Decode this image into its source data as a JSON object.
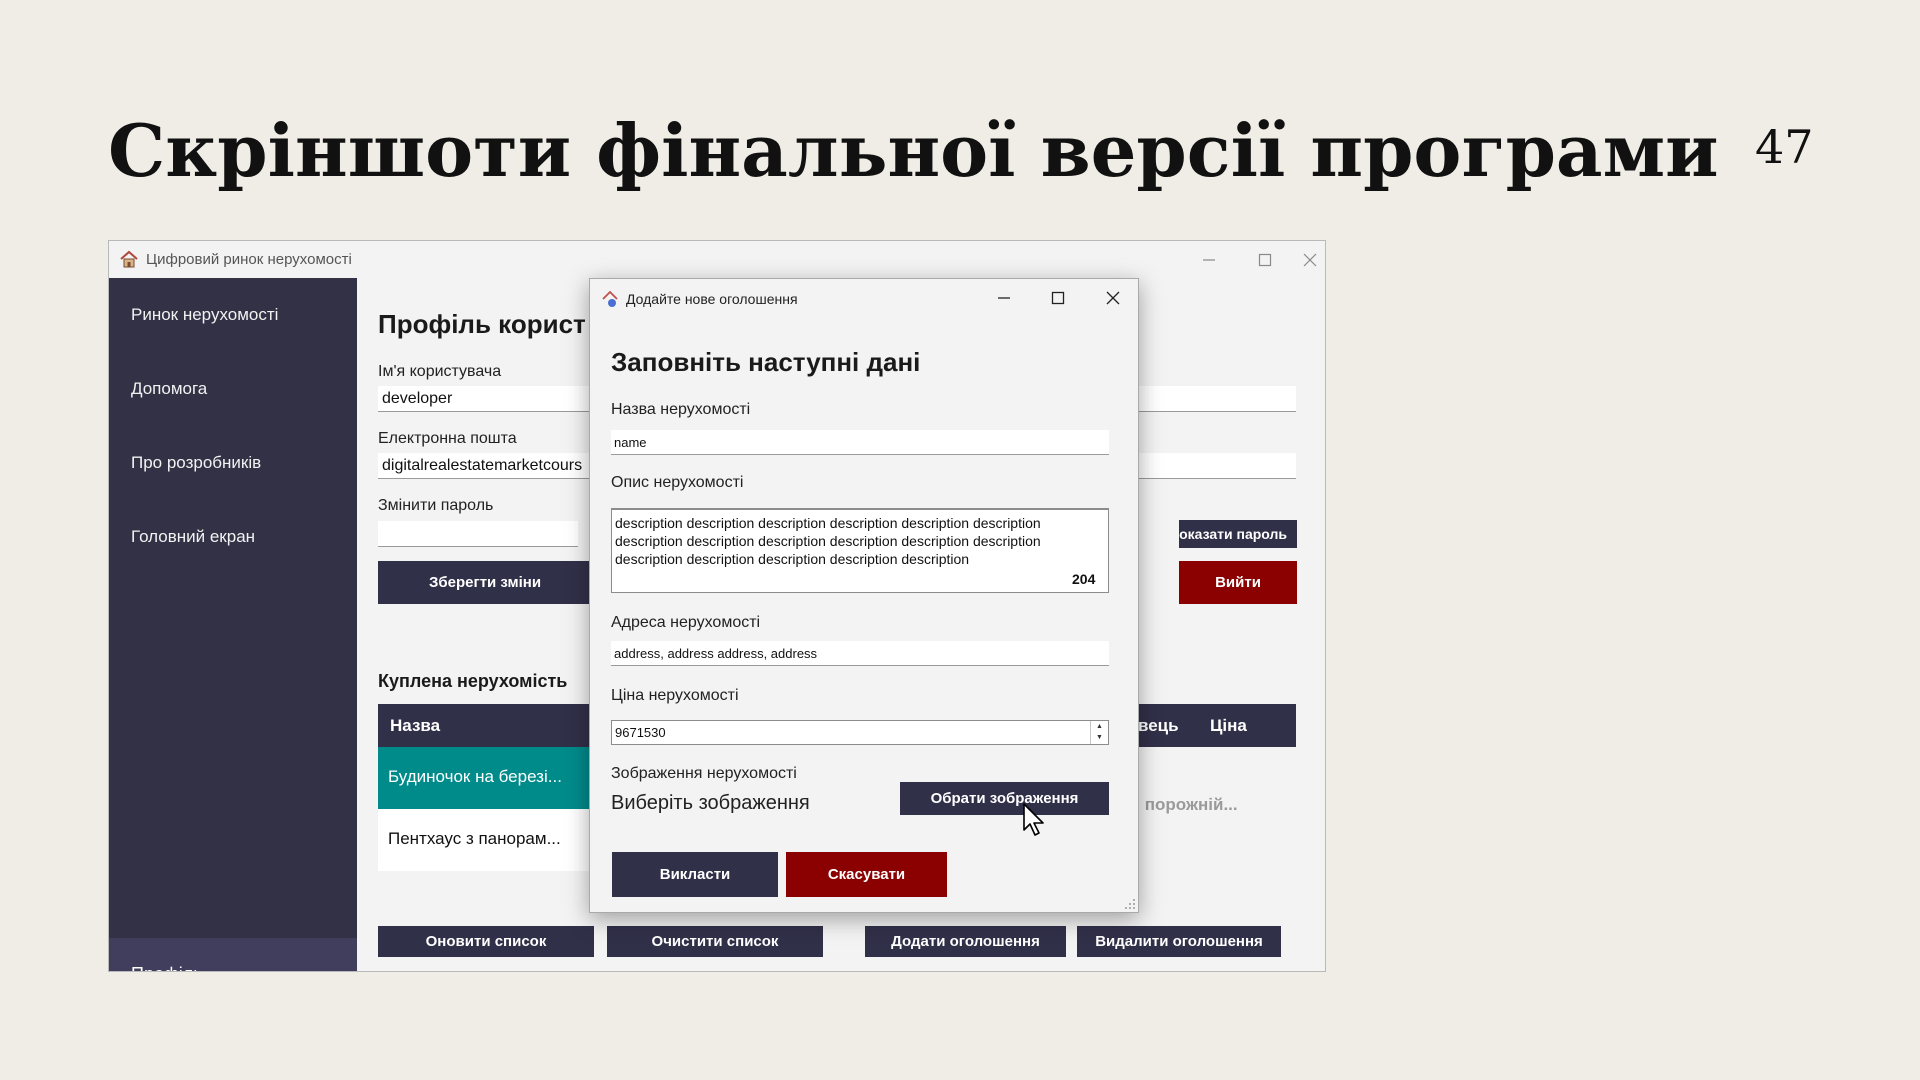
{
  "slide": {
    "title": "Скріншоти фінальної версії програми",
    "page_number": "47"
  },
  "app": {
    "title": "Цифровий ринок нерухомості",
    "sidebar": {
      "items": [
        "Ринок нерухомості",
        "Допомога",
        "Про розробників",
        "Головний екран"
      ],
      "active": "Профіль"
    },
    "profile": {
      "heading": "Профіль корист",
      "username_label": "Ім'я користувача",
      "username_value": "developer",
      "email_label": "Електронна пошта",
      "email_value": "digitalrealestatemarketcours",
      "password_label": "Змінити пароль",
      "show_password": "оказати пароль",
      "save_button": "Зберегти зміни",
      "logout_button": "Вийти",
      "purchased_heading": "Куплена нерухомість",
      "columns": [
        "Назва",
        "вець",
        "Ціна"
      ],
      "rows": [
        "Будиночок на березі...",
        "Пентхаус з панорам..."
      ],
      "empty_text": "ті порожній..."
    },
    "bottom_buttons": [
      "Оновити список",
      "Очистити список",
      "Додати оголошення",
      "Видалити оголошення"
    ]
  },
  "dialog": {
    "title": "Додайте нове оголошення",
    "heading": "Заповніть наступні дані",
    "name_label": "Назва нерухомості",
    "name_value": "name",
    "description_label": "Опис нерухомості",
    "description_value": "description description description description description description description description description description description description description description description description description",
    "char_count": "204",
    "address_label": "Адреса нерухомості",
    "address_value": "address, address address, address",
    "price_label": "Ціна нерухомості",
    "price_value": "9671530",
    "image_label": "Зображення нерухомості",
    "image_placeholder": "Виберіть зображення",
    "choose_image_button": "Обрати зображення",
    "publish_button": "Викласти",
    "cancel_button": "Скасувати"
  },
  "colors": {
    "sidebar": "#323146",
    "sidebar_active": "#403e5c",
    "dark_button": "#313049",
    "danger": "#8b0000",
    "selected_row": "#008b8b"
  },
  "icons": {
    "app": "house-icon",
    "minimize": "minimize-icon",
    "maximize": "maximize-icon",
    "close": "close-icon",
    "cursor": "mouse-pointer-icon"
  }
}
